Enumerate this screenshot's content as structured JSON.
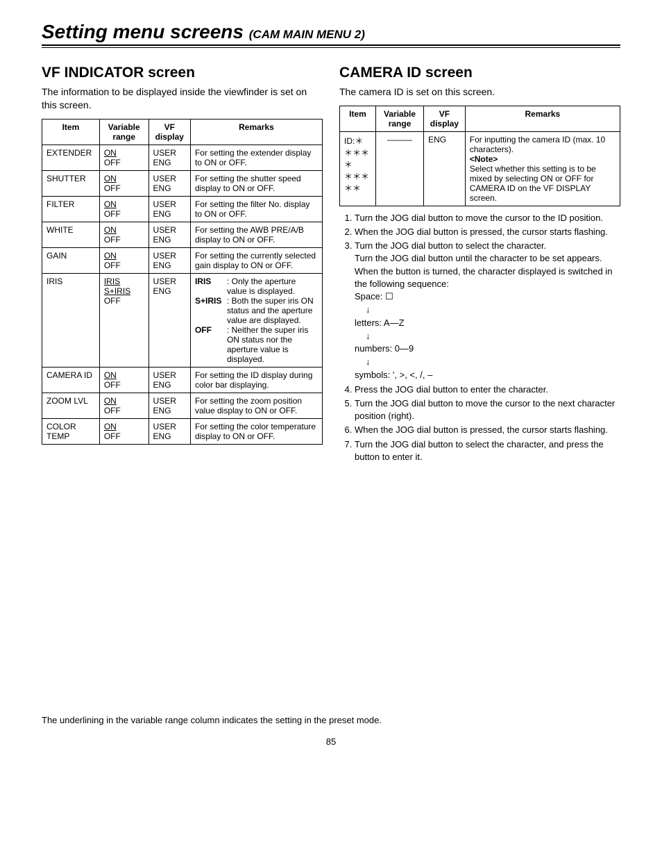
{
  "title": "Setting menu screens",
  "subtitle": "(CAM MAIN MENU 2)",
  "left": {
    "heading": "VF INDICATOR screen",
    "lead": "The information to be displayed inside the viewfinder is set on this screen.",
    "headers": {
      "item": "Item",
      "range": "Variable range",
      "vf": "VF display",
      "remarks": "Remarks"
    },
    "rows": {
      "extender": {
        "item": "EXTENDER",
        "r1": "ON",
        "r2": "OFF",
        "vf1": "USER",
        "vf2": "ENG",
        "remarks": "For setting the extender display to ON or OFF."
      },
      "shutter": {
        "item": "SHUTTER",
        "r1": "ON",
        "r2": "OFF",
        "vf1": "USER",
        "vf2": "ENG",
        "remarks": "For setting the shutter speed display to ON or OFF."
      },
      "filter": {
        "item": "FILTER",
        "r1": "ON",
        "r2": "OFF",
        "vf1": "USER",
        "vf2": "ENG",
        "remarks": "For setting the filter No. display to ON or OFF."
      },
      "white": {
        "item": "WHITE",
        "r1": "ON",
        "r2": "OFF",
        "vf1": "USER",
        "vf2": "ENG",
        "remarks": "For setting the AWB PRE/A/B display to ON or OFF."
      },
      "gain": {
        "item": "GAIN",
        "r1": "ON",
        "r2": "OFF",
        "vf1": "USER",
        "vf2": "ENG",
        "remarks": "For setting the currently selected gain display to ON or OFF."
      },
      "iris": {
        "item": "IRIS",
        "r1": "IRIS",
        "r2": "S+IRIS",
        "r3": "OFF",
        "vf1": "USER",
        "vf2": "ENG",
        "lbl1": "IRIS",
        "val1": ": Only the aperture value is displayed.",
        "lbl2": "S+IRIS",
        "val2": ": Both the super iris ON status and the aperture value are displayed.",
        "lbl3": "OFF",
        "val3": ": Neither the super iris ON status nor the aperture value is displayed."
      },
      "cameraid": {
        "item": "CAMERA ID",
        "r1": "ON",
        "r2": "OFF",
        "vf1": "USER",
        "vf2": "ENG",
        "remarks": "For setting the ID display during color bar displaying."
      },
      "zoom": {
        "item": "ZOOM LVL",
        "r1": "ON",
        "r2": "OFF",
        "vf1": "USER",
        "vf2": "ENG",
        "remarks": "For setting the zoom position value display to ON or OFF."
      },
      "colortemp": {
        "item": "COLOR TEMP",
        "r1": "ON",
        "r2": "OFF",
        "vf1": "USER",
        "vf2": "ENG",
        "remarks": "For setting the color temperature display to ON or OFF."
      }
    }
  },
  "right": {
    "heading": "CAMERA ID screen",
    "lead": "The camera ID is set on this screen.",
    "headers": {
      "item": "Item",
      "range": "Variable range",
      "vf": "VF display",
      "remarks": "Remarks"
    },
    "row": {
      "item1": "ID:＊＊＊＊＊",
      "item2": "＊＊＊＊＊",
      "range": "———",
      "vf": "ENG",
      "remarks_l1": "For inputting the camera ID (max. 10 characters).",
      "remarks_note": "<Note>",
      "remarks_l2": "Select whether this setting is to be mixed by selecting ON or OFF for CAMERA ID on the VF DISPLAY screen."
    },
    "steps": {
      "s1": "Turn the JOG dial button to move the cursor to the ID position.",
      "s2": "When the JOG dial button is pressed, the cursor starts flashing.",
      "s3a": "Turn the JOG dial button to select the character.",
      "s3b": "Turn the JOG dial button until the character to be set appears. When the button is turned, the character displayed is switched in the following sequence:",
      "seq_space": "Space: ☐",
      "seq_letters": "letters: A—Z",
      "seq_numbers": "numbers: 0—9",
      "seq_symbols": "symbols: ', >, <, /, –",
      "s4": "Press the JOG dial button to enter the character.",
      "s5": "Turn the JOG dial button to move the cursor to the next character position (right).",
      "s6": "When the JOG dial button is pressed, the cursor starts flashing.",
      "s7": "Turn the JOG dial button to select the character, and press the button to enter it."
    }
  },
  "footer": "The underlining in the variable range column indicates the setting in the preset mode.",
  "page_number": "85"
}
